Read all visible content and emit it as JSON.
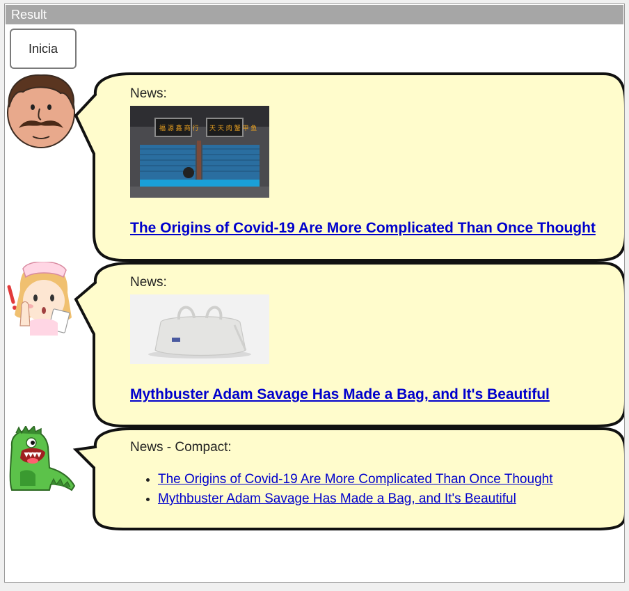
{
  "window": {
    "title": "Result"
  },
  "toolbar": {
    "start_label": "Inicia"
  },
  "messages": [
    {
      "label": "News:",
      "headline": "The Origins of Covid-19 Are More Complicated Than Once Thought",
      "image": "shuttered-market-photo"
    },
    {
      "label": "News:",
      "headline": "Mythbuster Adam Savage Has Made a Bag, and It's Beautiful",
      "image": "white-bag-photo"
    },
    {
      "label": "News - Compact:",
      "items": [
        "The Origins of Covid-19 Are More Complicated Than Once Thought",
        "Mythbuster Adam Savage Has Made a Bag, and It's Beautiful"
      ]
    }
  ],
  "avatars": [
    "mustache-man-avatar",
    "nurse-avatar",
    "green-dinosaur-avatar"
  ],
  "colors": {
    "bubble_fill": "#fffccc",
    "link": "#0000cc",
    "titlebar": "#a6a6a6"
  }
}
